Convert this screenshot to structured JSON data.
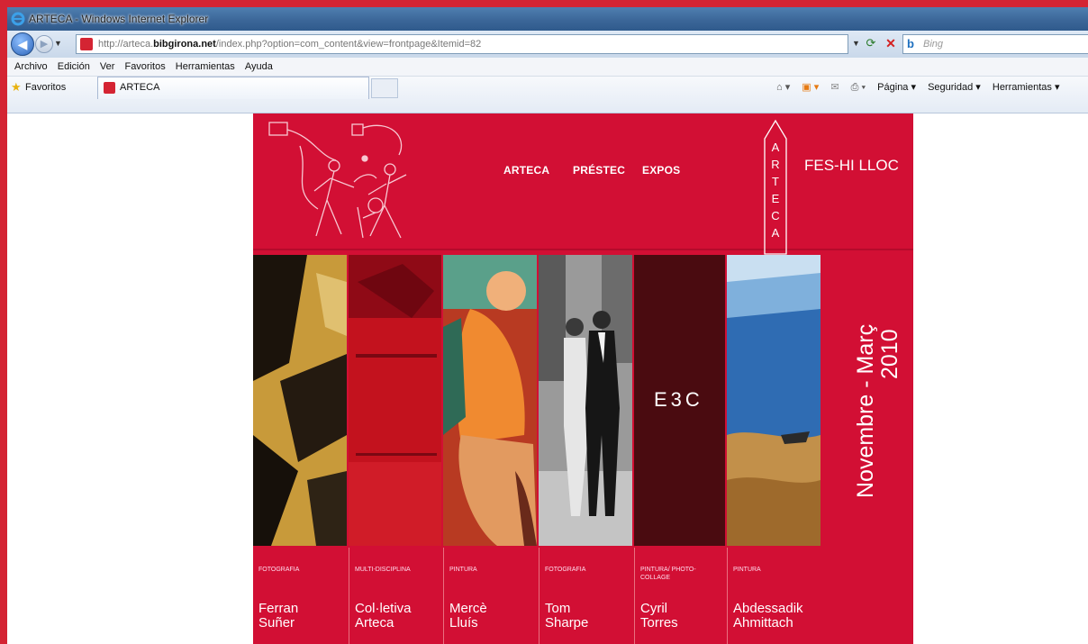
{
  "browser": {
    "window_title": "ARTECA - Windows Internet Explorer",
    "url_prefix": "http://arteca.",
    "url_domain": "bibgirona.net",
    "url_path": "/index.php?option=com_content&view=frontpage&Itemid=82",
    "search_placeholder": "Bing",
    "menu": [
      "Archivo",
      "Edición",
      "Ver",
      "Favoritos",
      "Herramientas",
      "Ayuda"
    ],
    "favorites_label": "Favoritos",
    "tab_label": "ARTECA",
    "commands": [
      "Página ▾",
      "Seguridad ▾",
      "Herramientas ▾"
    ]
  },
  "site": {
    "nav": [
      "ARTECA",
      "PRÉSTEC",
      "EXPOS"
    ],
    "vertical_logo": [
      "A",
      "R",
      "T",
      "E",
      "C",
      "A"
    ],
    "tagline": "FES-HI LLOC",
    "date_banner": {
      "line1": "Novembre - Març",
      "line2": "2010"
    },
    "badge_text": "E3C",
    "colors": {
      "brand_red": "#d20f34",
      "panel_dark": "#4a0b10"
    },
    "exhibitions": [
      {
        "category": "FOTOGRAFIA",
        "artist_first": "Ferran",
        "artist_last": "Suñer"
      },
      {
        "category": "MULTI-DISCIPLINA",
        "artist_first": "Col·letiva",
        "artist_last": "Arteca"
      },
      {
        "category": "PINTURA",
        "artist_first": "Mercè",
        "artist_last": "Lluís"
      },
      {
        "category": "FOTOGRAFIA",
        "artist_first": "Tom",
        "artist_last": "Sharpe"
      },
      {
        "category": "PINTURA/ PHOTO-COLLAGE",
        "artist_first": "Cyril",
        "artist_last": "Torres"
      },
      {
        "category": "PINTURA",
        "artist_first": "Abdessadik",
        "artist_last": "Ahmittach"
      }
    ]
  }
}
